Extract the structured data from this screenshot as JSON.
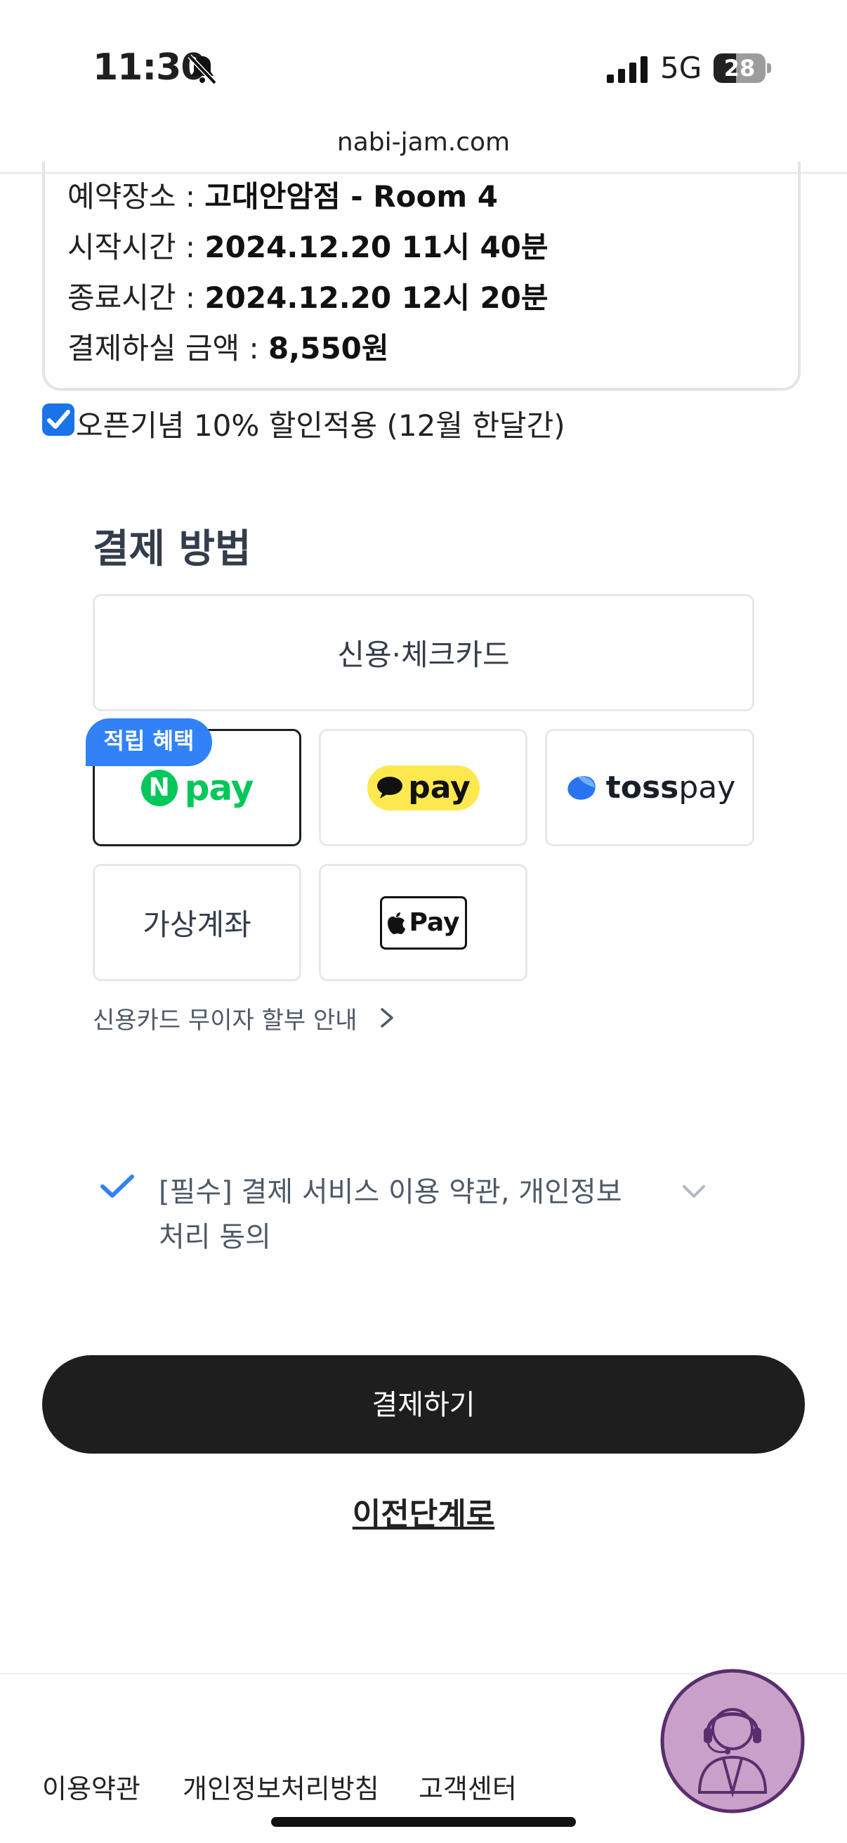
{
  "status_bar": {
    "time": "11:30",
    "network": "5G",
    "battery": "28"
  },
  "browser": {
    "url": "nabi-jam.com"
  },
  "summary": {
    "location_label": "예약장소 : ",
    "location_value": "고대안암점 - Room 4",
    "start_label": "시작시간 : ",
    "start_value": "2024.12.20 11시 40분",
    "end_label": "종료시간 : ",
    "end_value": "2024.12.20 12시 20분",
    "amount_label": "결제하실 금액 : ",
    "amount_value": "8,550원"
  },
  "discount": {
    "label": "오픈기념 10% 할인적용 (12월 한달간)",
    "checked": true
  },
  "payment": {
    "title": "결제 방법",
    "card": "신용·체크카드",
    "badge": "적립 혜택",
    "npay_n": "N",
    "npay_text": "pay",
    "kakao_text": "pay",
    "toss_text_bold": "toss",
    "toss_text": "pay",
    "virtual_account": "가상계좌",
    "apple_pay_text": "Pay",
    "installment_link": "신용카드 무이자 할부 안내"
  },
  "agreement": {
    "text": "[필수] 결제 서비스 이용 약관, 개인정보 처리 동의",
    "checked": true
  },
  "actions": {
    "pay_button": "결제하기",
    "back_link": "이전단계로"
  },
  "footer": {
    "terms": "이용약관",
    "privacy": "개인정보처리방침",
    "support": "고객센터"
  },
  "colors": {
    "accent": "#3182f6",
    "checkbox": "#1a73e8",
    "button": "#1e1e1e",
    "npay": "#03c75a",
    "kakao": "#fde84f"
  }
}
